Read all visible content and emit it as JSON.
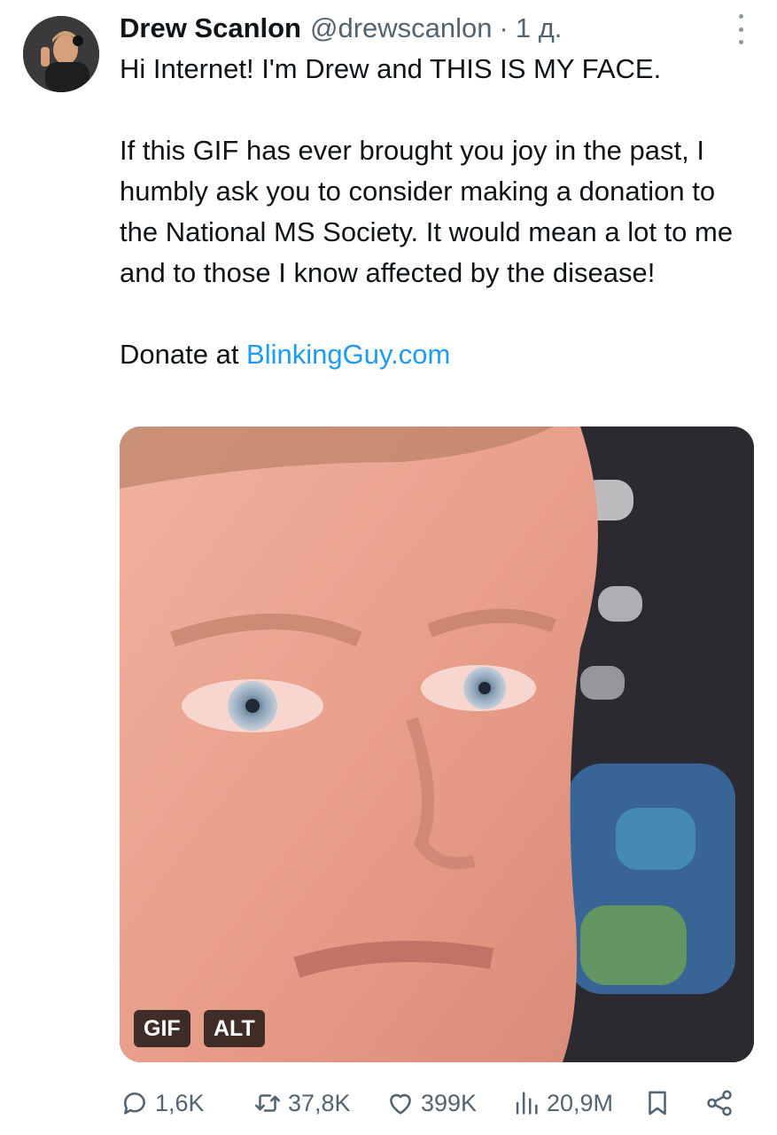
{
  "tweet": {
    "author": {
      "name": "Drew Scanlon",
      "handle": "@drewscanlon",
      "separator": "·",
      "time": "1 д."
    },
    "text": {
      "line1": "Hi Internet! I'm Drew and THIS IS MY FACE.",
      "paragraph2": "If this GIF has ever brought you joy in the past, I humbly ask you to consider making a donation to the National MS Society. It would mean a lot to me and to those I know affected by the disease!",
      "donate_prefix": "Donate at ",
      "donate_link": "BlinkingGuy.com"
    },
    "media": {
      "gif_badge": "GIF",
      "alt_badge": "ALT"
    },
    "actions": {
      "replies": "1,6K",
      "retweets": "37,8K",
      "likes": "399K",
      "views": "20,9M"
    },
    "icons": {
      "reply": "reply-icon",
      "retweet": "retweet-icon",
      "like": "heart-icon",
      "views": "views-icon",
      "bookmark": "bookmark-icon",
      "share": "share-icon",
      "more": "more-icon"
    },
    "colors": {
      "link": "#1d9bf0",
      "secondary_text": "#536471",
      "text": "#0f1419"
    }
  }
}
